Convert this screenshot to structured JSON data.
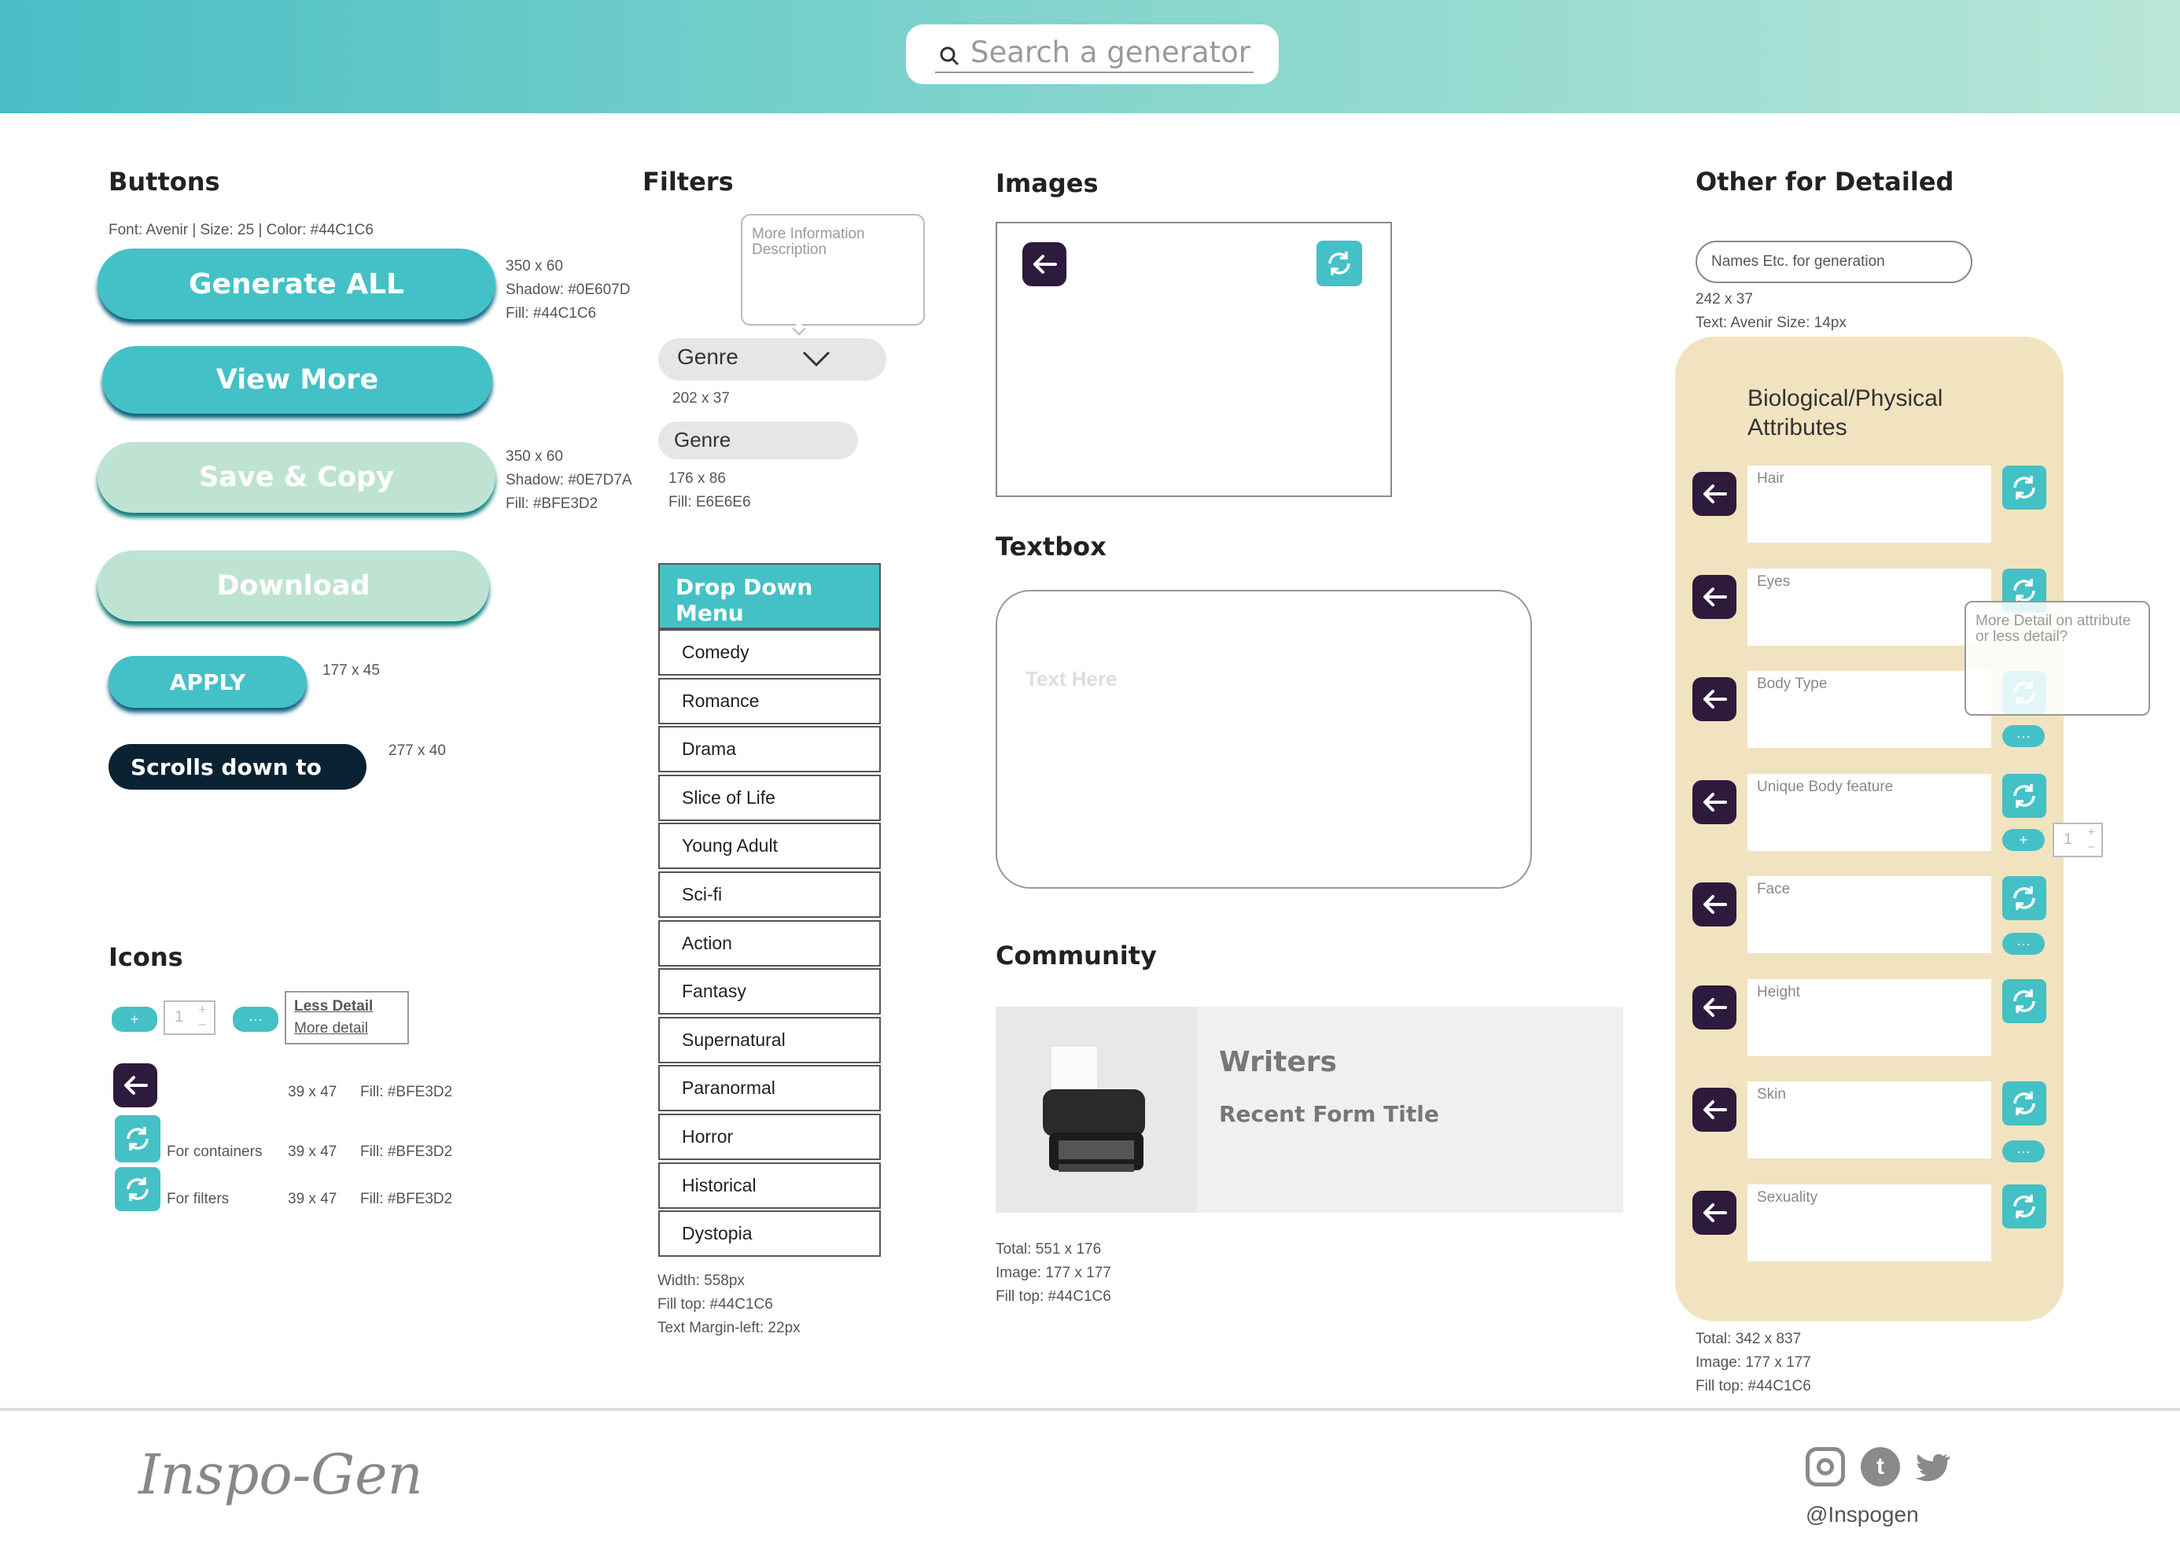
{
  "header": {
    "search_placeholder": "Search a generator"
  },
  "buttons": {
    "heading": "Buttons",
    "font_note": "Font: Avenir |  Size: 25 | Color: #44C1C6",
    "generate_all": "Generate ALL",
    "view_more": "View More",
    "save_copy": "Save  & Copy",
    "download": "Download",
    "apply": "APPLY",
    "scrolls": "Scrolls down to",
    "note1": [
      "350 x 60",
      "Shadow: #0E607D",
      "Fill: #44C1C6"
    ],
    "note2": [
      "350 x 60",
      "Shadow: #0E7D7A",
      "Fill: #BFE3D2"
    ],
    "apply_size": "177 x 45",
    "scroll_size": "277 x 40"
  },
  "icons": {
    "heading": "Icons",
    "stepper_value": "1",
    "less_detail": "Less Detail",
    "more_detail": "More detail",
    "rows": [
      {
        "label": "",
        "size": "39 x 47",
        "fill": "Fill: #BFE3D2"
      },
      {
        "label": "For containers",
        "size": "39 x 47",
        "fill": "Fill: #BFE3D2"
      },
      {
        "label": "For filters",
        "size": "39 x 47",
        "fill": "Fill: #BFE3D2"
      }
    ]
  },
  "filters": {
    "heading": "Filters",
    "tooltip": "More Information Description",
    "genre": "Genre",
    "genre_size": "202 x 37",
    "genre2": "Genre",
    "genre2_note": [
      "176 x 86",
      "Fill: E6E6E6"
    ],
    "dropdown_title": "Drop Down Menu",
    "items": [
      "Comedy",
      "Romance",
      "Drama",
      "Slice of Life",
      "Young Adult",
      "Sci-fi",
      "Action",
      "Fantasy",
      "Supernatural",
      "Paranormal",
      "Horror",
      "Historical",
      "Dystopia"
    ],
    "notes": [
      "Width: 558px",
      "Fill top: #44C1C6",
      "Text Margin-left: 22px"
    ]
  },
  "images": {
    "heading": "Images"
  },
  "textbox": {
    "heading": "Textbox",
    "placeholder": "Text Here"
  },
  "community": {
    "heading": "Community",
    "title": "Writers",
    "subtitle": "Recent Form Title",
    "notes": [
      "Total: 551 x 176",
      "Image: 177 x 177",
      "Fill top: #44C1C6"
    ]
  },
  "detailed": {
    "heading": "Other for Detailed",
    "names_placeholder": "Names Etc. for generation",
    "names_notes": [
      "242 x 37",
      "Text: Avenir  Size: 14px"
    ],
    "panel_title": "Biological/Physical Attributes",
    "tooltip": "More Detail on attribute or less detail?",
    "stepper_value": "1",
    "fields": [
      "Hair",
      "Eyes",
      "Body Type",
      "Unique Body feature",
      "Face",
      "Height",
      "Skin",
      "Sexuality"
    ],
    "notes": [
      "Total: 342 x 837",
      "Image: 177 x 177",
      "Fill top: #44C1C6"
    ]
  },
  "footer": {
    "logo": "Inspo-Gen",
    "handle": "@Inspogen"
  },
  "colors": {
    "accent": "#44C1C6",
    "light": "#BFE3D2",
    "dark": "#2d1a3d",
    "panel": "#f2e3c0"
  }
}
